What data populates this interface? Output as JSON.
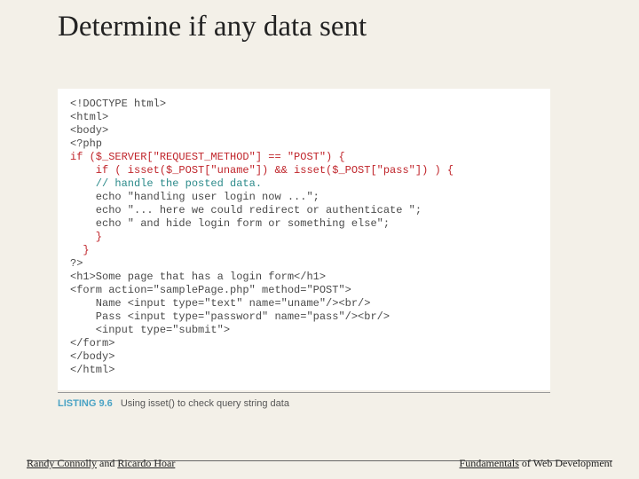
{
  "title": "Determine if any data sent",
  "code": {
    "l1": "<!DOCTYPE html>",
    "l2": "<html>",
    "l3": "<body>",
    "l4": "<?php",
    "l5": "if ($_SERVER[\"REQUEST_METHOD\"] == \"POST\") {",
    "l6": "    if ( isset($_POST[\"uname\"]) && isset($_POST[\"pass\"]) ) {",
    "l7": "    // handle the posted data.",
    "l8": "    echo \"handling user login now ...\";",
    "l9": "    echo \"... here we could redirect or authenticate \";",
    "l10": "    echo \" and hide login form or something else\";",
    "l11": "    }",
    "l12": "  }",
    "l13": "",
    "l14": "?>",
    "l15": "<h1>Some page that has a login form</h1>",
    "l16": "<form action=\"samplePage.php\" method=\"POST\">",
    "l17": "    Name <input type=\"text\" name=\"uname\"/><br/>",
    "l18": "    Pass <input type=\"password\" name=\"pass\"/><br/>",
    "l19": "    <input type=\"submit\">",
    "l20": "</form>",
    "l21": "</body>",
    "l22": "</html>"
  },
  "listing": {
    "label": "LISTING 9.6",
    "caption": "Using isset() to check query string data"
  },
  "footer": {
    "left_parts": [
      "Randy Connolly",
      " and ",
      "Ricardo Hoar"
    ],
    "right_parts": [
      "Fundamentals",
      " of Web Development"
    ]
  }
}
